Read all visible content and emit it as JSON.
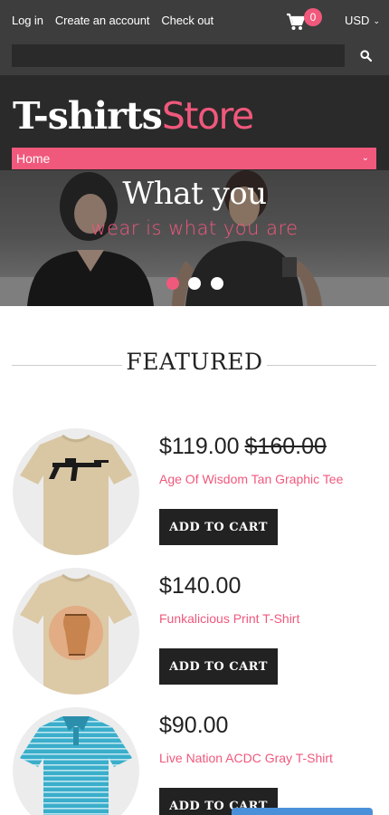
{
  "topbar": {
    "links": [
      "Log in",
      "Create an account",
      "Check out"
    ],
    "cart_count": "0",
    "currency": "USD",
    "search_placeholder": ""
  },
  "header": {
    "logo_part1": "T-shirts",
    "logo_part2": "Store",
    "nav_label": "Home"
  },
  "hero": {
    "title": "What you",
    "subtitle": "wear is what you are",
    "slides": 3,
    "active_slide": 1
  },
  "featured": {
    "title": "FEATURED",
    "products": [
      {
        "price": "$119.00",
        "old_price": "$160.00",
        "name": "Age Of Wisdom Tan Graphic Tee",
        "button": "ADD TO CART"
      },
      {
        "price": "$140.00",
        "old_price": "",
        "name": "Funkalicious Print T-Shirt",
        "button": "ADD TO CART"
      },
      {
        "price": "$90.00",
        "old_price": "",
        "name": "Live Nation ACDC Gray T-Shirt",
        "button": "ADD TO CART"
      }
    ]
  },
  "colors": {
    "accent": "#f0587c",
    "dark": "#2a2a2a",
    "topbar": "#3d3d3d"
  },
  "icons": {
    "cart": "cart-icon",
    "search": "search-icon",
    "chevron": "chevron-down-icon"
  }
}
